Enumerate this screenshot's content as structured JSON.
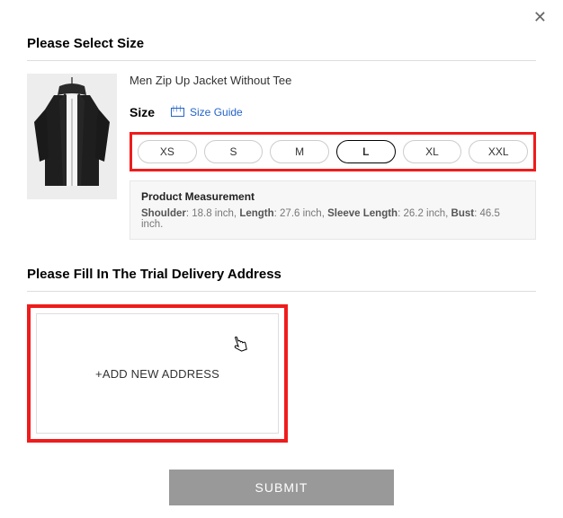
{
  "close_label": "✕",
  "section1": {
    "title": "Please Select Size"
  },
  "product": {
    "name": "Men Zip Up Jacket Without Tee",
    "size_label": "Size",
    "size_guide_label": "Size Guide",
    "sizes": {
      "s0": "XS",
      "s1": "S",
      "s2": "M",
      "s3": "L",
      "s4": "XL",
      "s5": "XXL"
    },
    "selected_size_index": 3,
    "measurement": {
      "title": "Product Measurement",
      "shoulder_label": "Shoulder",
      "shoulder_value": ": 18.8 inch, ",
      "length_label": "Length",
      "length_value": ": 27.6 inch, ",
      "sleeve_label": "Sleeve Length",
      "sleeve_value": ": 26.2 inch, ",
      "bust_label": "Bust",
      "bust_value": ": 46.5 inch."
    }
  },
  "section2": {
    "title": "Please Fill In The Trial Delivery Address",
    "add_address_label": "+ADD NEW ADDRESS"
  },
  "submit": {
    "label": "SUBMIT"
  }
}
